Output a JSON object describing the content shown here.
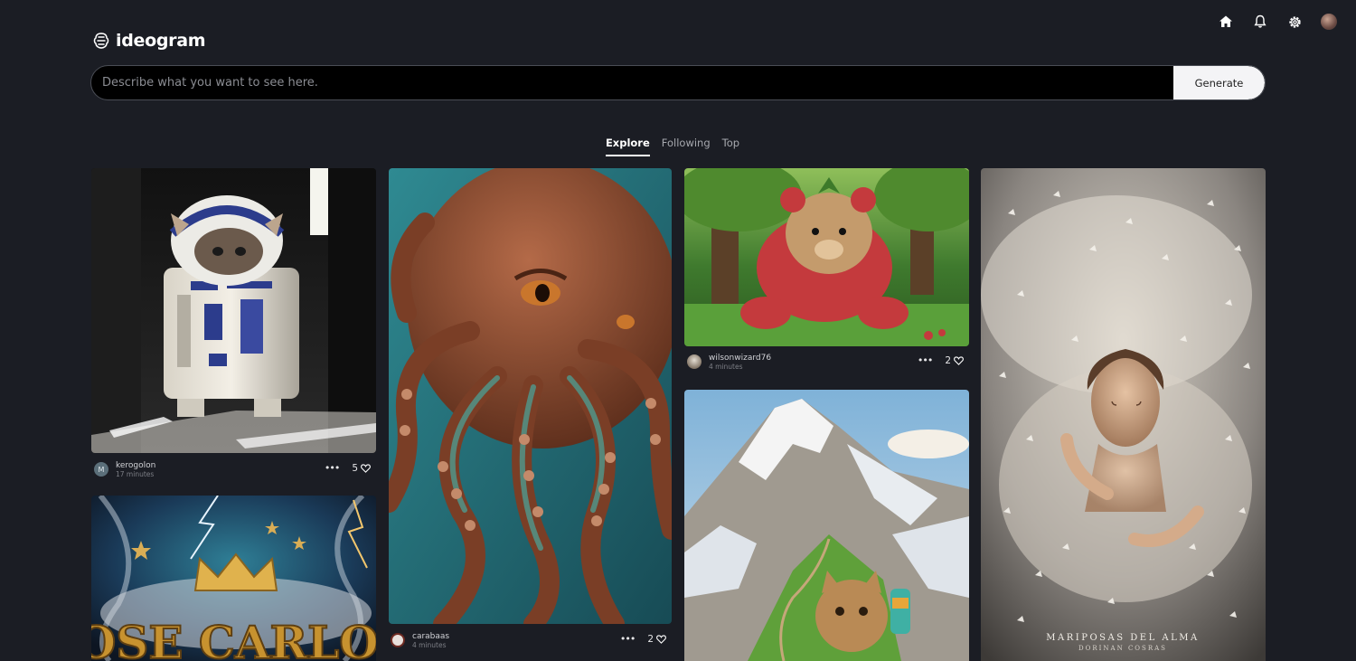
{
  "app": {
    "name": "ideogram"
  },
  "nav_icons": [
    "home-icon",
    "bell-icon",
    "gear-icon",
    "user-avatar"
  ],
  "search": {
    "placeholder": "Describe what you want to see here.",
    "value": "",
    "button_label": "Generate"
  },
  "tabs": [
    {
      "label": "Explore",
      "active": true
    },
    {
      "label": "Following",
      "active": false
    },
    {
      "label": "Top",
      "active": false
    }
  ],
  "cards": [
    {
      "user": "kerogolon",
      "time": "17 minutes",
      "likes": "5",
      "avatar_letter": "M",
      "subject": "R2-D2 kitten robot"
    },
    {
      "user": "carabaas",
      "time": "4 minutes",
      "likes": "2",
      "subject": "octopus sculpture"
    },
    {
      "user": "wilsonwizard76",
      "time": "4 minutes",
      "likes": "2",
      "subject": "strawberry bear"
    },
    {
      "user": "",
      "time": "",
      "likes": "",
      "subject": "mountain cat hiker"
    },
    {
      "user": "",
      "time": "",
      "likes": "",
      "subject": "woman with butterflies"
    },
    {
      "user": "",
      "time": "",
      "likes": "",
      "subject": "crown poster"
    }
  ],
  "image_text": {
    "crown_poster": "JOSE CARLOS",
    "butterfly_title": "MARIPOSAS DEL ALMA",
    "butterfly_subtitle": "DORINAN COSRAS"
  },
  "colors": {
    "background": "#1b1d24",
    "accent": "#ffffff",
    "button_bg": "#f4f4f6"
  }
}
